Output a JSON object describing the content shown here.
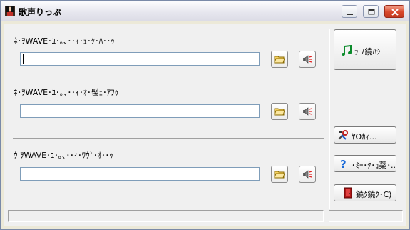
{
  "window": {
    "title": "歌声りっぷ",
    "controls": [
      "minimize-icon",
      "maximize-icon",
      "close-icon"
    ]
  },
  "inputs": [
    {
      "label": "ﾈ･ｦWAVE･ﾕ･｡､･･ｨ･ｪ･ｸ･ﾊ･･ｩ",
      "value": ""
    },
    {
      "label": "ﾈ･ｦWAVE･ﾕ･｡､･･ｨ･ｵ･髢ｪ･ｱﾌｩ",
      "value": ""
    },
    {
      "label": "ｳ ｦWAVE･ﾕ･｡､･･ｨ･ﾜｳ`･ｵ･･ｩ",
      "value": ""
    }
  ],
  "buttons": {
    "main": "ﾗ ﾉ鐃ﾊｼ",
    "settings": "ﾔOｶｨ...",
    "help": "･ﾐｰ･ｸ･ｮ蘂･..",
    "exit": "鐃ｸ鐃ｸ･C)"
  },
  "icons": {
    "browse": "folder-icon",
    "play": "speaker-icon",
    "main": "music-note-icon",
    "settings": "tools-icon",
    "help": "question-icon",
    "exit": "exit-door-icon"
  },
  "status": [
    "",
    ""
  ]
}
